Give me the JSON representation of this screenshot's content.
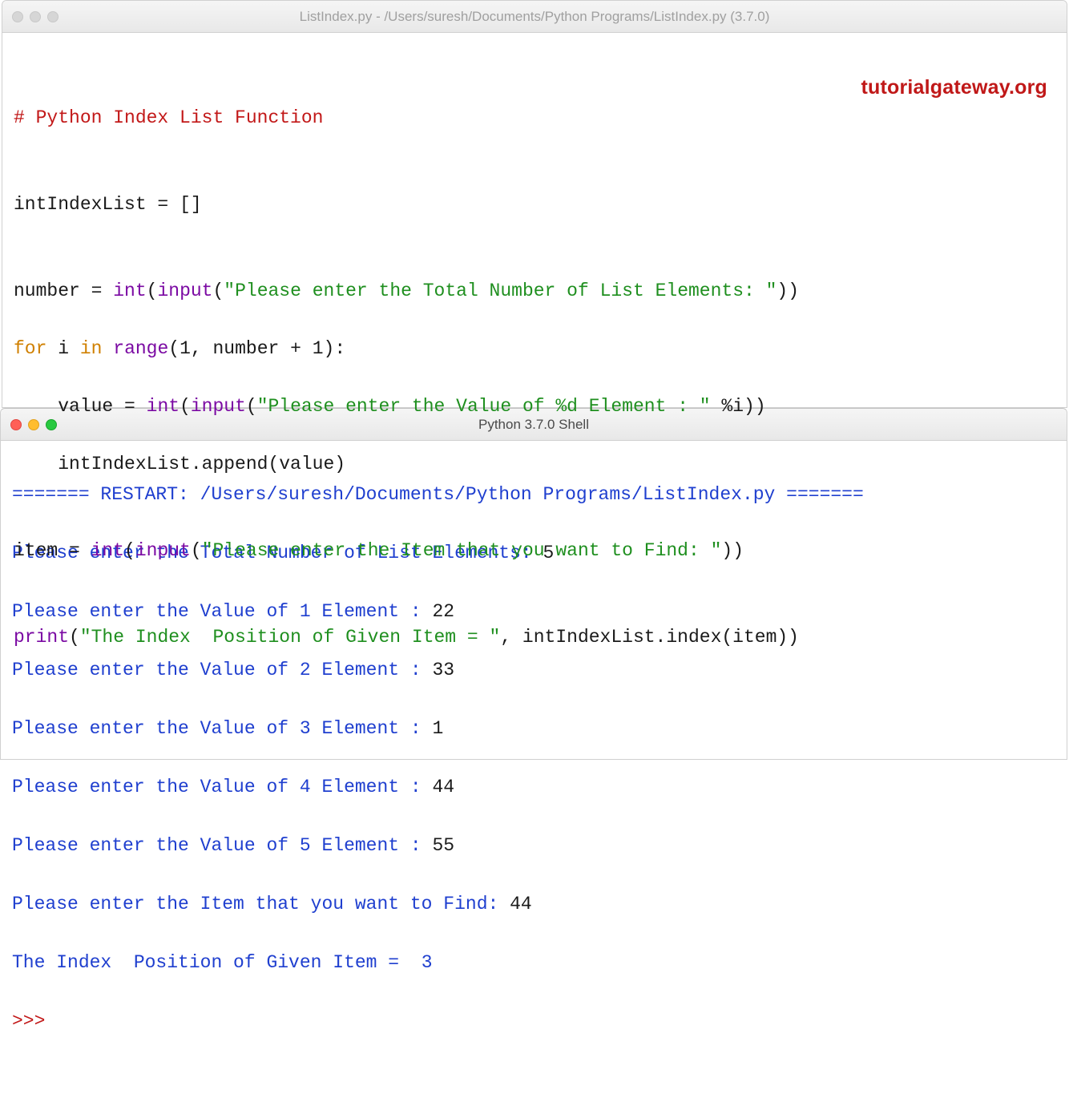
{
  "editor": {
    "title": "ListIndex.py - /Users/suresh/Documents/Python Programs/ListIndex.py (3.7.0)",
    "watermark": "tutorialgateway.org",
    "code": {
      "l1": "# Python Index List Function",
      "l2": "",
      "l3_a": "intIndexList = []",
      "l4": "",
      "l5_a": "number = ",
      "l5_b": "int",
      "l5_c": "(",
      "l5_d": "input",
      "l5_e": "(",
      "l5_f": "\"Please enter the Total Number of List Elements: \"",
      "l5_g": "))",
      "l6_a": "for",
      "l6_b": " i ",
      "l6_c": "in",
      "l6_d": " ",
      "l6_e": "range",
      "l6_f": "(1, number + 1):",
      "l7_a": "    value = ",
      "l7_b": "int",
      "l7_c": "(",
      "l7_d": "input",
      "l7_e": "(",
      "l7_f": "\"Please enter the Value of %d Element : \"",
      "l7_g": " %i))",
      "l8_a": "    intIndexList.append(value)",
      "l9": "",
      "l10_a": "item = ",
      "l10_b": "int",
      "l10_c": "(",
      "l10_d": "input",
      "l10_e": "(",
      "l10_f": "\"Please enter the Item that you want to Find: \"",
      "l10_g": "))",
      "l11": "",
      "l12_a": "print",
      "l12_b": "(",
      "l12_c": "\"The Index  Position of Given Item = \"",
      "l12_d": ", intIndexList.index(item))"
    }
  },
  "shell": {
    "title": "Python 3.7.0 Shell",
    "restart_line": "======= RESTART: /Users/suresh/Documents/Python Programs/ListIndex.py =======",
    "lines": [
      {
        "prompt": "Please enter the Total Number of List Elements: ",
        "val": "5"
      },
      {
        "prompt": "Please enter the Value of 1 Element : ",
        "val": "22"
      },
      {
        "prompt": "Please enter the Value of 2 Element : ",
        "val": "33"
      },
      {
        "prompt": "Please enter the Value of 3 Element : ",
        "val": "1"
      },
      {
        "prompt": "Please enter the Value of 4 Element : ",
        "val": "44"
      },
      {
        "prompt": "Please enter the Value of 5 Element : ",
        "val": "55"
      },
      {
        "prompt": "Please enter the Item that you want to Find: ",
        "val": "44"
      }
    ],
    "result_prompt": "The Index  Position of Given Item =  ",
    "result_val": "3",
    "next_prompt": ">>> "
  }
}
